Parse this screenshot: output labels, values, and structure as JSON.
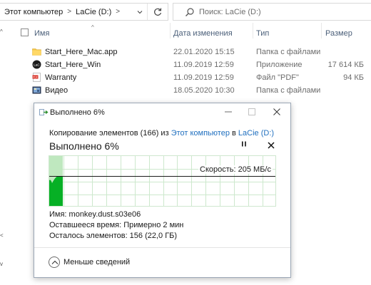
{
  "explorer": {
    "address": {
      "crumb_pc": "Этот компьютер",
      "crumb_drive": "LaCie (D:)"
    },
    "search": {
      "placeholder": "Поиск: LaCie (D:)"
    },
    "columns": {
      "name": "Имя",
      "date": "Дата изменения",
      "type": "Тип",
      "size": "Размер"
    },
    "files": [
      {
        "name": "Start_Here_Mac.app",
        "date": "22.01.2020 15:15",
        "type": "Папка с файлами",
        "size": "",
        "icon": "folder-icon"
      },
      {
        "name": "Start_Here_Win",
        "date": "11.09.2019 12:59",
        "type": "Приложение",
        "size": "17 614 КБ",
        "icon": "lacie-app-icon"
      },
      {
        "name": "Warranty",
        "date": "11.09.2019 12:59",
        "type": "Файл \"PDF\"",
        "size": "94 КБ",
        "icon": "pdf-icon"
      },
      {
        "name": "Видео",
        "date": "18.05.2020 10:30",
        "type": "Папка с файлами",
        "size": "",
        "icon": "video-folder-icon"
      }
    ]
  },
  "dialog": {
    "title": "Выполнено 6%",
    "copy_prefix": "Копирование элементов (166) из",
    "copy_src": "Этот компьютер",
    "copy_in": "в",
    "copy_dst": "LaCie (D:)",
    "progress_title": "Выполнено 6%",
    "progress_percent": 6,
    "speed_label": "Скорость: 205 МБ/с",
    "name_line": "Имя: monkey.dust.s03e06",
    "time_line": "Оставшееся время: Примерно 2 мин",
    "items_line": "Осталось элементов: 156 (22,0 ГБ)",
    "less_details": "Меньше сведений",
    "colors": {
      "progress_fill": "#06b025",
      "progress_light": "#bfe8bf",
      "grid": "#cde8cd",
      "link": "#1f6fbf"
    }
  }
}
